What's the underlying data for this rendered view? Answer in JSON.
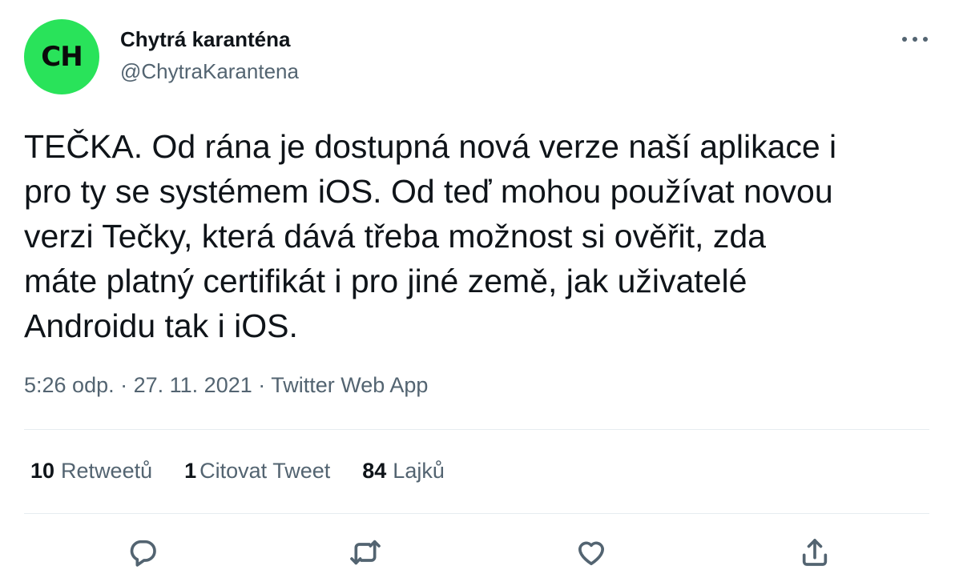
{
  "author": {
    "avatar_text": "CH",
    "avatar_color": "#29e35a",
    "display_name": "Chytrá karanténa",
    "handle": "@ChytraKarantena"
  },
  "tweet": {
    "text": "TEČKA. Od rána je dostupná nová verze naší aplikace i\npro ty se systémem iOS. Od teď mohou používat novou\nverzi Tečky, která dává třeba možnost si ověřit, zda\nmáte platný certifikát i pro jiné země, jak uživatelé\nAndroidu tak i iOS.",
    "time": "5:26 odp.",
    "separator": " · ",
    "date": "27. 11. 2021",
    "source": "Twitter Web App"
  },
  "stats": {
    "retweets_count": "10",
    "retweets_label": "Retweetů",
    "quotes_count": "1",
    "quotes_label": "Citovat Tweet",
    "likes_count": "84",
    "likes_label": "Lajků"
  },
  "icons": {
    "more": "more-horizontal-icon",
    "reply": "reply-icon",
    "retweet": "retweet-icon",
    "like": "heart-icon",
    "share": "share-icon"
  },
  "colors": {
    "text_primary": "#0f1419",
    "text_secondary": "#536471",
    "divider": "#e6ecf0"
  }
}
